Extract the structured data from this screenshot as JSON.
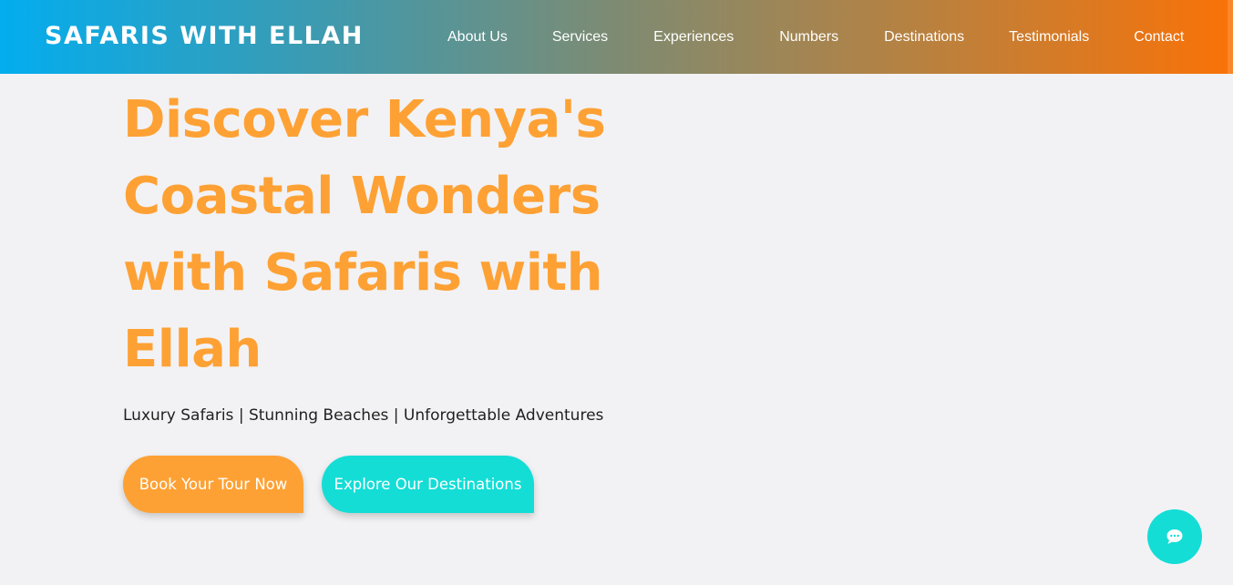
{
  "header": {
    "brand": "SAFARIS WITH ELLAH",
    "nav": [
      {
        "label": "About Us"
      },
      {
        "label": "Services"
      },
      {
        "label": "Experiences"
      },
      {
        "label": "Numbers"
      },
      {
        "label": "Destinations"
      },
      {
        "label": "Testimonials"
      },
      {
        "label": "Contact"
      }
    ]
  },
  "hero": {
    "title_lines": [
      "Discover Kenya's",
      "Coastal Wonders",
      "with Safaris with",
      "Ellah"
    ],
    "tagline": "Luxury Safaris | Stunning Beaches | Unforgettable Adventures",
    "primary_cta": "Book Your Tour Now",
    "secondary_cta": "Explore Our Destinations"
  },
  "chat": {
    "icon": "chat-bubble-icon"
  },
  "colors": {
    "accent_orange": "#fea134",
    "accent_teal": "#14ddd6",
    "header_gradient_start": "#03adef",
    "header_gradient_end": "#fa7207",
    "background": "#f2f2f4"
  }
}
